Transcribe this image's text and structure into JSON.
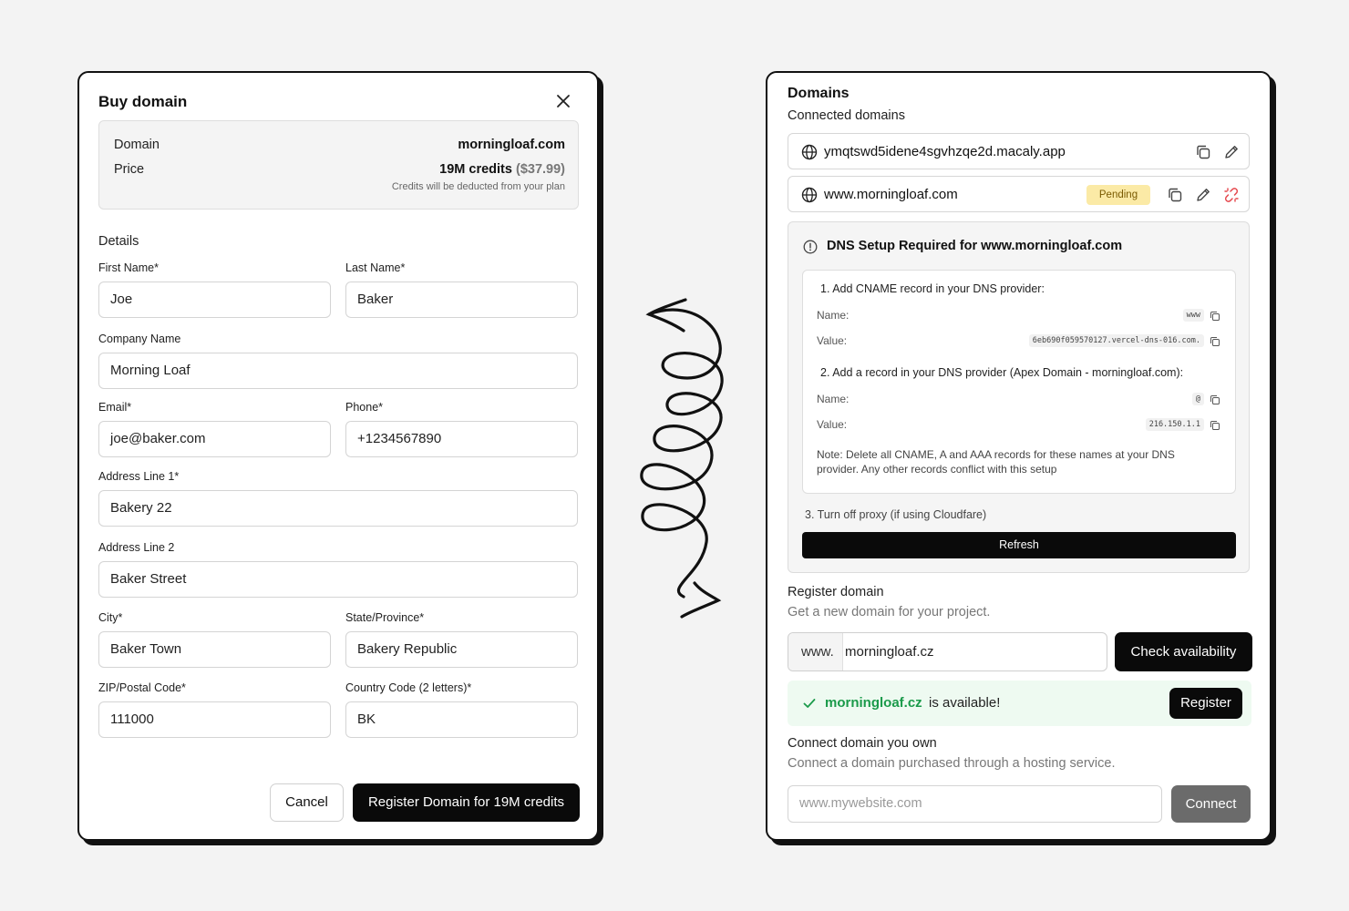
{
  "buy_modal": {
    "title": "Buy domain",
    "summary": {
      "domain_label": "Domain",
      "domain_value": "morningloaf.com",
      "price_label": "Price",
      "price_credits": "19M credits",
      "price_money": "($37.99)",
      "note": "Credits will be deducted from your plan"
    },
    "details_title": "Details",
    "fields": {
      "first_name": {
        "label": "First Name*",
        "value": "Joe"
      },
      "last_name": {
        "label": "Last Name*",
        "value": "Baker"
      },
      "company": {
        "label": "Company Name",
        "value": "Morning Loaf"
      },
      "email": {
        "label": "Email*",
        "value": "joe@baker.com"
      },
      "phone": {
        "label": "Phone*",
        "value": "+1234567890"
      },
      "address1": {
        "label": "Address Line 1*",
        "value": "Bakery 22"
      },
      "address2": {
        "label": "Address Line 2",
        "value": "Baker Street"
      },
      "city": {
        "label": "City*",
        "value": "Baker Town"
      },
      "state": {
        "label": "State/Province*",
        "value": "Bakery Republic"
      },
      "zip": {
        "label": "ZIP/Postal Code*",
        "value": "111000"
      },
      "country": {
        "label": "Country Code (2 letters)*",
        "value": "BK"
      }
    },
    "cancel_label": "Cancel",
    "register_label": "Register Domain for 19M credits"
  },
  "domains_panel": {
    "title": "Domains",
    "connected_title": "Connected domains",
    "connected": [
      {
        "name": "ymqtswd5idene4sgvhzqe2d.macaly.app"
      },
      {
        "name": "www.morningloaf.com",
        "status": "Pending"
      }
    ],
    "dns": {
      "title": "DNS Setup Required for www.morningloaf.com",
      "step1": "1. Add CNAME record in your DNS provider:",
      "step1_name_label": "Name:",
      "step1_name_value": "www",
      "step1_value_label": "Value:",
      "step1_value_value": "6eb690f059570127.vercel-dns-016.com.",
      "step2": "2. Add a record in your DNS provider (Apex Domain - morningloaf.com):",
      "step2_name_label": "Name:",
      "step2_name_value": "@",
      "step2_value_label": "Value:",
      "step2_value_value": "216.150.1.1",
      "note": "Note: Delete all CNAME, A and AAA records for these names at your DNS provider. Any other records conflict with this setup",
      "step3": "3. Turn off proxy (if using Cloudfare)",
      "refresh_label": "Refresh"
    },
    "register": {
      "title": "Register domain",
      "subtitle": "Get a new domain for your project.",
      "prefix": "www.",
      "value": "morningloaf.cz",
      "check_label": "Check availability",
      "available_name": "morningloaf.cz",
      "available_text": "is available!",
      "register_label": "Register"
    },
    "connect": {
      "title": "Connect domain you own",
      "subtitle": "Connect a domain purchased through a hosting service.",
      "placeholder": "www.mywebsite.com",
      "connect_label": "Connect"
    }
  },
  "colors": {
    "accent_dark": "#0a0a0a",
    "pending_bg": "#fbeaa6",
    "available_green": "#1a9a4a",
    "unlink_red": "#e5484d"
  }
}
